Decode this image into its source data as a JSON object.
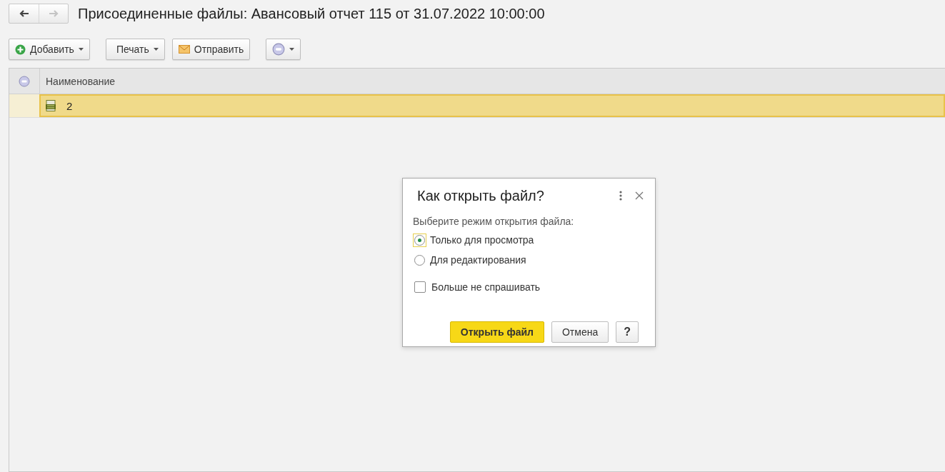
{
  "window": {
    "title": "Присоединенные файлы: Авансовый отчет 115 от 31.07.2022 10:00:00",
    "nav": [
      {
        "kind": "back",
        "disabled": false
      },
      {
        "kind": "forward",
        "disabled": true
      }
    ]
  },
  "toolbar": [
    {
      "kind": "add",
      "label": "Добавить",
      "dropdown": true
    },
    {
      "kind": "plain",
      "label": "Печать",
      "dropdown": true
    },
    {
      "kind": "send",
      "label": "Отправить",
      "dropdown": false
    },
    {
      "kind": "more",
      "dropdown": true
    }
  ],
  "table": {
    "columns": [
      "Наименование"
    ],
    "rows": [
      {
        "name": "2",
        "selected": true
      }
    ]
  },
  "dialog": {
    "title": "Как открыть файл?",
    "prompt": "Выберите режим открытия файла:",
    "options": [
      {
        "label": "Только для просмотра",
        "selected": true
      },
      {
        "label": "Для редактирования",
        "selected": false
      }
    ],
    "dont_ask": {
      "label": "Больше не спрашивать",
      "checked": false
    },
    "buttons": [
      {
        "kind": "primary",
        "label": "Открыть файл"
      },
      {
        "kind": "normal",
        "label": "Отмена"
      },
      {
        "kind": "help",
        "label": "?"
      }
    ]
  }
}
